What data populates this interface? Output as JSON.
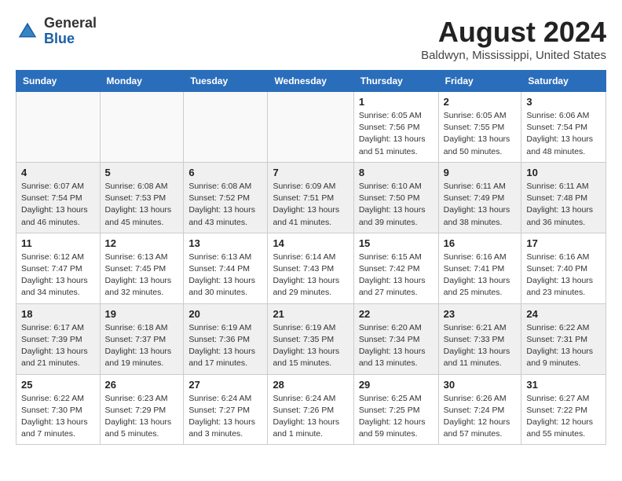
{
  "header": {
    "logo_general": "General",
    "logo_blue": "Blue",
    "month_year": "August 2024",
    "location": "Baldwyn, Mississippi, United States"
  },
  "days_of_week": [
    "Sunday",
    "Monday",
    "Tuesday",
    "Wednesday",
    "Thursday",
    "Friday",
    "Saturday"
  ],
  "weeks": [
    [
      {
        "day": "",
        "content": ""
      },
      {
        "day": "",
        "content": ""
      },
      {
        "day": "",
        "content": ""
      },
      {
        "day": "",
        "content": ""
      },
      {
        "day": "1",
        "content": "Sunrise: 6:05 AM\nSunset: 7:56 PM\nDaylight: 13 hours\nand 51 minutes."
      },
      {
        "day": "2",
        "content": "Sunrise: 6:05 AM\nSunset: 7:55 PM\nDaylight: 13 hours\nand 50 minutes."
      },
      {
        "day": "3",
        "content": "Sunrise: 6:06 AM\nSunset: 7:54 PM\nDaylight: 13 hours\nand 48 minutes."
      }
    ],
    [
      {
        "day": "4",
        "content": "Sunrise: 6:07 AM\nSunset: 7:54 PM\nDaylight: 13 hours\nand 46 minutes."
      },
      {
        "day": "5",
        "content": "Sunrise: 6:08 AM\nSunset: 7:53 PM\nDaylight: 13 hours\nand 45 minutes."
      },
      {
        "day": "6",
        "content": "Sunrise: 6:08 AM\nSunset: 7:52 PM\nDaylight: 13 hours\nand 43 minutes."
      },
      {
        "day": "7",
        "content": "Sunrise: 6:09 AM\nSunset: 7:51 PM\nDaylight: 13 hours\nand 41 minutes."
      },
      {
        "day": "8",
        "content": "Sunrise: 6:10 AM\nSunset: 7:50 PM\nDaylight: 13 hours\nand 39 minutes."
      },
      {
        "day": "9",
        "content": "Sunrise: 6:11 AM\nSunset: 7:49 PM\nDaylight: 13 hours\nand 38 minutes."
      },
      {
        "day": "10",
        "content": "Sunrise: 6:11 AM\nSunset: 7:48 PM\nDaylight: 13 hours\nand 36 minutes."
      }
    ],
    [
      {
        "day": "11",
        "content": "Sunrise: 6:12 AM\nSunset: 7:47 PM\nDaylight: 13 hours\nand 34 minutes."
      },
      {
        "day": "12",
        "content": "Sunrise: 6:13 AM\nSunset: 7:45 PM\nDaylight: 13 hours\nand 32 minutes."
      },
      {
        "day": "13",
        "content": "Sunrise: 6:13 AM\nSunset: 7:44 PM\nDaylight: 13 hours\nand 30 minutes."
      },
      {
        "day": "14",
        "content": "Sunrise: 6:14 AM\nSunset: 7:43 PM\nDaylight: 13 hours\nand 29 minutes."
      },
      {
        "day": "15",
        "content": "Sunrise: 6:15 AM\nSunset: 7:42 PM\nDaylight: 13 hours\nand 27 minutes."
      },
      {
        "day": "16",
        "content": "Sunrise: 6:16 AM\nSunset: 7:41 PM\nDaylight: 13 hours\nand 25 minutes."
      },
      {
        "day": "17",
        "content": "Sunrise: 6:16 AM\nSunset: 7:40 PM\nDaylight: 13 hours\nand 23 minutes."
      }
    ],
    [
      {
        "day": "18",
        "content": "Sunrise: 6:17 AM\nSunset: 7:39 PM\nDaylight: 13 hours\nand 21 minutes."
      },
      {
        "day": "19",
        "content": "Sunrise: 6:18 AM\nSunset: 7:37 PM\nDaylight: 13 hours\nand 19 minutes."
      },
      {
        "day": "20",
        "content": "Sunrise: 6:19 AM\nSunset: 7:36 PM\nDaylight: 13 hours\nand 17 minutes."
      },
      {
        "day": "21",
        "content": "Sunrise: 6:19 AM\nSunset: 7:35 PM\nDaylight: 13 hours\nand 15 minutes."
      },
      {
        "day": "22",
        "content": "Sunrise: 6:20 AM\nSunset: 7:34 PM\nDaylight: 13 hours\nand 13 minutes."
      },
      {
        "day": "23",
        "content": "Sunrise: 6:21 AM\nSunset: 7:33 PM\nDaylight: 13 hours\nand 11 minutes."
      },
      {
        "day": "24",
        "content": "Sunrise: 6:22 AM\nSunset: 7:31 PM\nDaylight: 13 hours\nand 9 minutes."
      }
    ],
    [
      {
        "day": "25",
        "content": "Sunrise: 6:22 AM\nSunset: 7:30 PM\nDaylight: 13 hours\nand 7 minutes."
      },
      {
        "day": "26",
        "content": "Sunrise: 6:23 AM\nSunset: 7:29 PM\nDaylight: 13 hours\nand 5 minutes."
      },
      {
        "day": "27",
        "content": "Sunrise: 6:24 AM\nSunset: 7:27 PM\nDaylight: 13 hours\nand 3 minutes."
      },
      {
        "day": "28",
        "content": "Sunrise: 6:24 AM\nSunset: 7:26 PM\nDaylight: 13 hours\nand 1 minute."
      },
      {
        "day": "29",
        "content": "Sunrise: 6:25 AM\nSunset: 7:25 PM\nDaylight: 12 hours\nand 59 minutes."
      },
      {
        "day": "30",
        "content": "Sunrise: 6:26 AM\nSunset: 7:24 PM\nDaylight: 12 hours\nand 57 minutes."
      },
      {
        "day": "31",
        "content": "Sunrise: 6:27 AM\nSunset: 7:22 PM\nDaylight: 12 hours\nand 55 minutes."
      }
    ]
  ]
}
